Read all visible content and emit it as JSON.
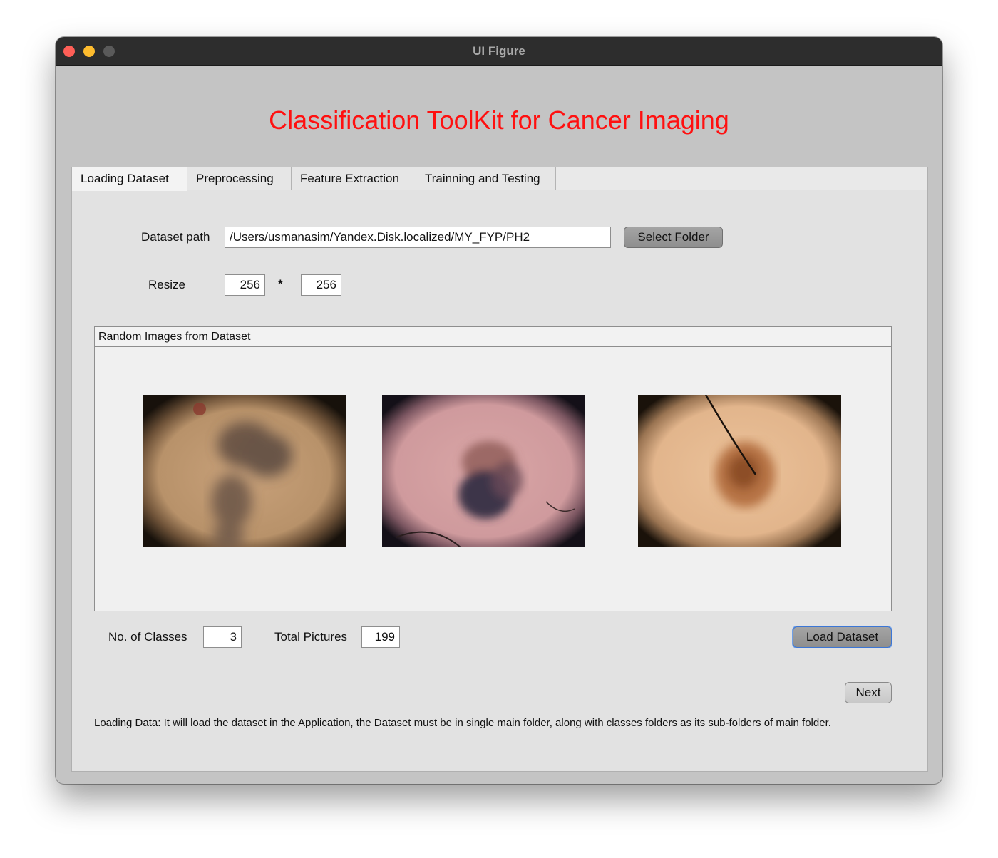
{
  "window": {
    "title": "UI Figure"
  },
  "app": {
    "title": "Classification ToolKit for Cancer Imaging"
  },
  "tabs": [
    {
      "label": "Loading Dataset",
      "active": true
    },
    {
      "label": "Preprocessing",
      "active": false
    },
    {
      "label": "Feature Extraction",
      "active": false
    },
    {
      "label": "Trainning and Testing",
      "active": false
    }
  ],
  "dataset": {
    "path_label": "Dataset path",
    "path_value": "/Users/usmanasim/Yandex.Disk.localized/MY_FYP/PH2",
    "select_button": "Select Folder",
    "resize_label": "Resize",
    "resize_width": "256",
    "resize_sep": "*",
    "resize_height": "256"
  },
  "preview": {
    "title": "Random Images from Dataset",
    "images": [
      "dermoscopy-image-1",
      "dermoscopy-image-2",
      "dermoscopy-image-3"
    ]
  },
  "stats": {
    "classes_label": "No. of Classes",
    "classes_value": "3",
    "pictures_label": "Total Pictures",
    "pictures_value": "199",
    "load_button": "Load Dataset"
  },
  "navigation": {
    "next_button": "Next"
  },
  "help_text": "Loading Data: It will load the dataset in the Application, the Dataset must be in single main folder, along with classes folders as its sub-folders of main folder.",
  "colors": {
    "title_red": "#ff1010",
    "titlebar": "#2d2d2d",
    "focus_blue": "#3b76d6"
  }
}
